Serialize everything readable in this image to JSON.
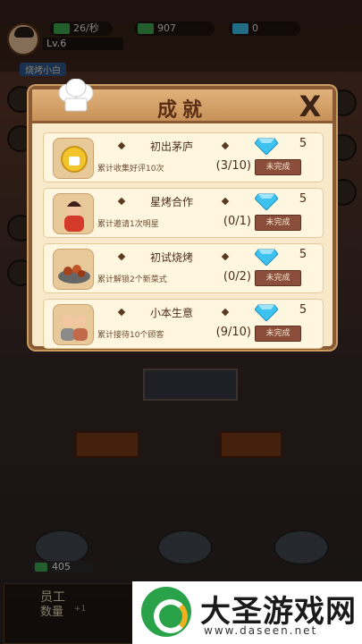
{
  "hud": {
    "rate": "26/秒",
    "cash": "907",
    "gems": "0",
    "level": "Lv.6",
    "rank": "烧烤小白"
  },
  "modal": {
    "title": "成就",
    "close_label": "X",
    "achievements": [
      {
        "name": "初出茅庐",
        "desc": "累计收集好评10次",
        "reward": "5",
        "progress": "(3/10)",
        "status": "未完成",
        "icon": "thumbs-up-icon"
      },
      {
        "name": "星烤合作",
        "desc": "累计邀请1次明星",
        "reward": "5",
        "progress": "(0/1)",
        "status": "未完成",
        "icon": "star-icon"
      },
      {
        "name": "初试烧烤",
        "desc": "累计解锁2个新菜式",
        "reward": "5",
        "progress": "(0/2)",
        "status": "未完成",
        "icon": "bbq-dish-icon"
      },
      {
        "name": "小本生意",
        "desc": "累计接待10个顾客",
        "reward": "5",
        "progress": "(9/10)",
        "status": "未完成",
        "icon": "customers-icon"
      }
    ]
  },
  "bottom": {
    "money": "405",
    "staff_title": "员工",
    "staff_count_label": "数量",
    "staff_count_delta": "+1"
  },
  "watermark": {
    "cn": "大圣游戏网",
    "url": "www.daseen.net"
  },
  "colors": {
    "accent": "#8a5a34",
    "panel": "#f7e9c9",
    "status_button": "#8a4e3a",
    "gem": "#3ec3f0"
  }
}
